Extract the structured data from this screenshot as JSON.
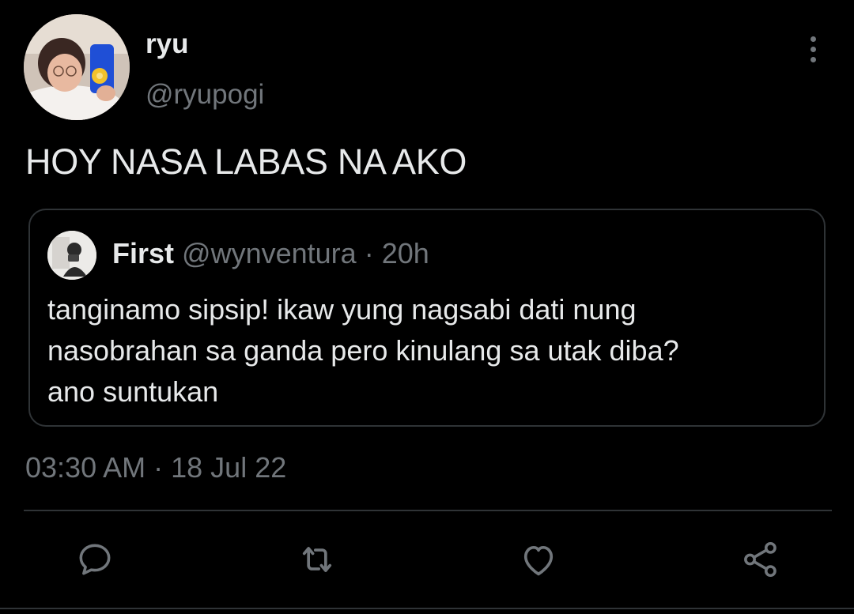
{
  "tweet": {
    "author_name": "ryu",
    "author_handle": "@ryupogi",
    "text": "HOY NASA LABAS NA AKO",
    "time": "03:30 AM",
    "separator": "·",
    "date": "18 Jul 22"
  },
  "quoted_tweet": {
    "author_name": "First",
    "author_handle": "@wynventura",
    "separator": "·",
    "time_ago": "20h",
    "text_line_1": "tanginamo sipsip! ikaw yung nagsabi dati nung",
    "text_line_2": "nasobrahan sa ganda pero kinulang sa utak diba?",
    "text_line_3": "ano suntukan"
  },
  "actions": {
    "icons": [
      "reply-icon",
      "retweet-icon",
      "like-icon",
      "share-icon"
    ]
  },
  "colors": {
    "background": "#000000",
    "primary_text": "#e7e9ea",
    "secondary_text": "#71767b",
    "border": "#2f3336"
  }
}
